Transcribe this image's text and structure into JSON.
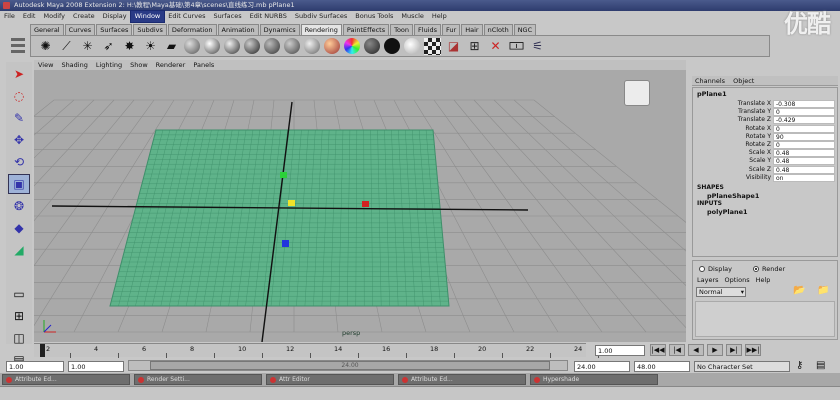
{
  "window": {
    "title": "Autodesk Maya 2008 Extension 2: H:\\教程\\Maya基础\\第4章\\scenes\\直线练习.mb    pPlane1",
    "logo": "优酷"
  },
  "menubar": [
    "File",
    "Edit",
    "Modify",
    "Create",
    "Display",
    "Window",
    "Edit Curves",
    "Surfaces",
    "Edit NURBS",
    "Subdiv Surfaces",
    "Bonus Tools",
    "Muscle",
    "Help"
  ],
  "menubar_selected_index": 5,
  "shelf_tabs": [
    "General",
    "Curves",
    "Surfaces",
    "Subdivs",
    "Deformation",
    "Animation",
    "Dynamics",
    "Rendering",
    "PaintEffects",
    "Toon",
    "Fluids",
    "Fur",
    "Hair",
    "nCloth",
    "NGC"
  ],
  "shelf_active_index": 7,
  "viewport": {
    "menu": [
      "View",
      "Shading",
      "Lighting",
      "Show",
      "Renderer",
      "Panels"
    ],
    "camera_label": "persp"
  },
  "channel_box": {
    "tabs": [
      "Channels",
      "Object"
    ],
    "object_name": "pPlane1",
    "attributes": [
      {
        "name": "Translate X",
        "value": "-0.308"
      },
      {
        "name": "Translate Y",
        "value": "0"
      },
      {
        "name": "Translate Z",
        "value": "-0.429"
      },
      {
        "name": "Rotate X",
        "value": "0"
      },
      {
        "name": "Rotate Y",
        "value": "90"
      },
      {
        "name": "Rotate Z",
        "value": "0"
      },
      {
        "name": "Scale X",
        "value": "0.48"
      },
      {
        "name": "Scale Y",
        "value": "0.48"
      },
      {
        "name": "Scale Z",
        "value": "0.48"
      },
      {
        "name": "Visibility",
        "value": "on"
      }
    ],
    "shapes_label": "SHAPES",
    "shape_name": "pPlaneShape1",
    "inputs_label": "INPUTS",
    "input_name": "polyPlane1"
  },
  "layer_editor": {
    "mode_display": "Display",
    "mode_render": "Render",
    "menu": [
      "Layers",
      "Options",
      "Help"
    ],
    "dropdown_value": "Normal"
  },
  "time_slider": {
    "ticks": [
      "2",
      "4",
      "6",
      "8",
      "10",
      "12",
      "14",
      "16",
      "18",
      "20",
      "22",
      "24"
    ],
    "current_frame": "1.00"
  },
  "range_slider": {
    "start_time": "1.00",
    "start_range": "1.00",
    "range_label": "24.00",
    "end_range": "24.00",
    "end_time": "48.00",
    "character_set": "No Character Set"
  },
  "taskbar": [
    "Attribute Ed...",
    "Render Setti...",
    "Attr Editor",
    "Attribute Ed...",
    "Hypershade"
  ],
  "colors": {
    "plane_fill": "#5fb38a",
    "plane_grid": "#3e8f6a",
    "viewport_bg": "#a9a9a9",
    "menu_highlight": "#2a3b86"
  }
}
